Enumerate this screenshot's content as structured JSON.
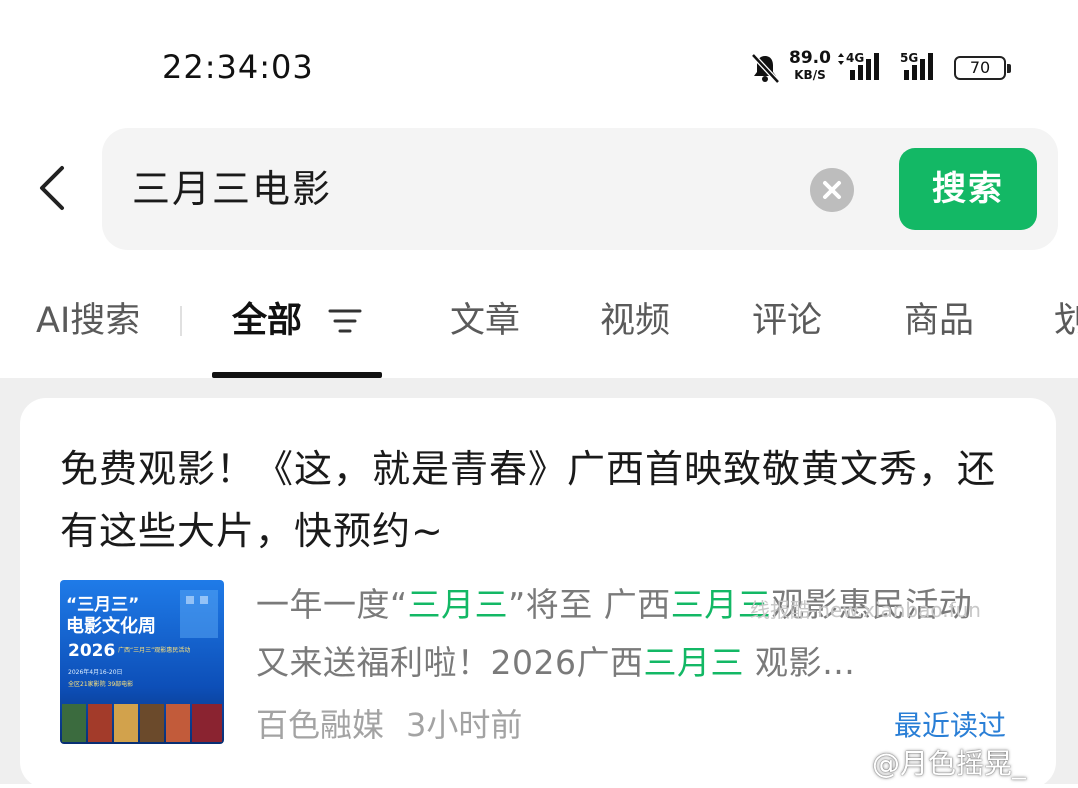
{
  "status_bar": {
    "time": "22:34:03",
    "net_speed_value": "89.0",
    "net_speed_unit": "KB/S",
    "signal_1_label": "4G",
    "signal_2_label": "5G",
    "battery": "70",
    "icons": [
      "bell-muted-icon",
      "signal-4g-icon",
      "signal-5g-icon",
      "battery-icon"
    ]
  },
  "search": {
    "query": "三月三电影",
    "button_label": "搜索",
    "icons": [
      "back-arrow-icon",
      "clear-icon"
    ]
  },
  "tabs": [
    {
      "label": "AI搜索"
    },
    {
      "label": "全部"
    },
    {
      "label": "文章"
    },
    {
      "label": "视频"
    },
    {
      "label": "评论"
    },
    {
      "label": "商品"
    },
    {
      "label": "划"
    }
  ],
  "active_tab": "全部",
  "result": {
    "title": "免费观影！《这，就是青春》广西首映致敬黄文秀，还有这些大片，快预约~",
    "snippet": {
      "p1": "一年一度“",
      "h1": "三月三",
      "p2": "”将至 广西",
      "h2": "三月三",
      "p3": "观影惠民活动又来送福利啦！2026广西",
      "h3": "三月三",
      "p4": " 观影…"
    },
    "source": "百色融媒",
    "time_ago": "3小时前",
    "recent_label": "最近读过",
    "thumbnail": {
      "line1": "“三月三”",
      "line2": "电影文化周",
      "line3": "2026",
      "line4": "广西“三月三”观影惠民活动",
      "line5": "2026年4月16-20日",
      "line6": "全区21家影院 39部电影"
    }
  },
  "watermarks": {
    "mid": "线报酷-new.xianbao.fun",
    "corner": "@月色摇晃_"
  },
  "colors": {
    "accent_green": "#13b865",
    "link_blue": "#2a7fd6",
    "background_gray": "#efefef"
  }
}
